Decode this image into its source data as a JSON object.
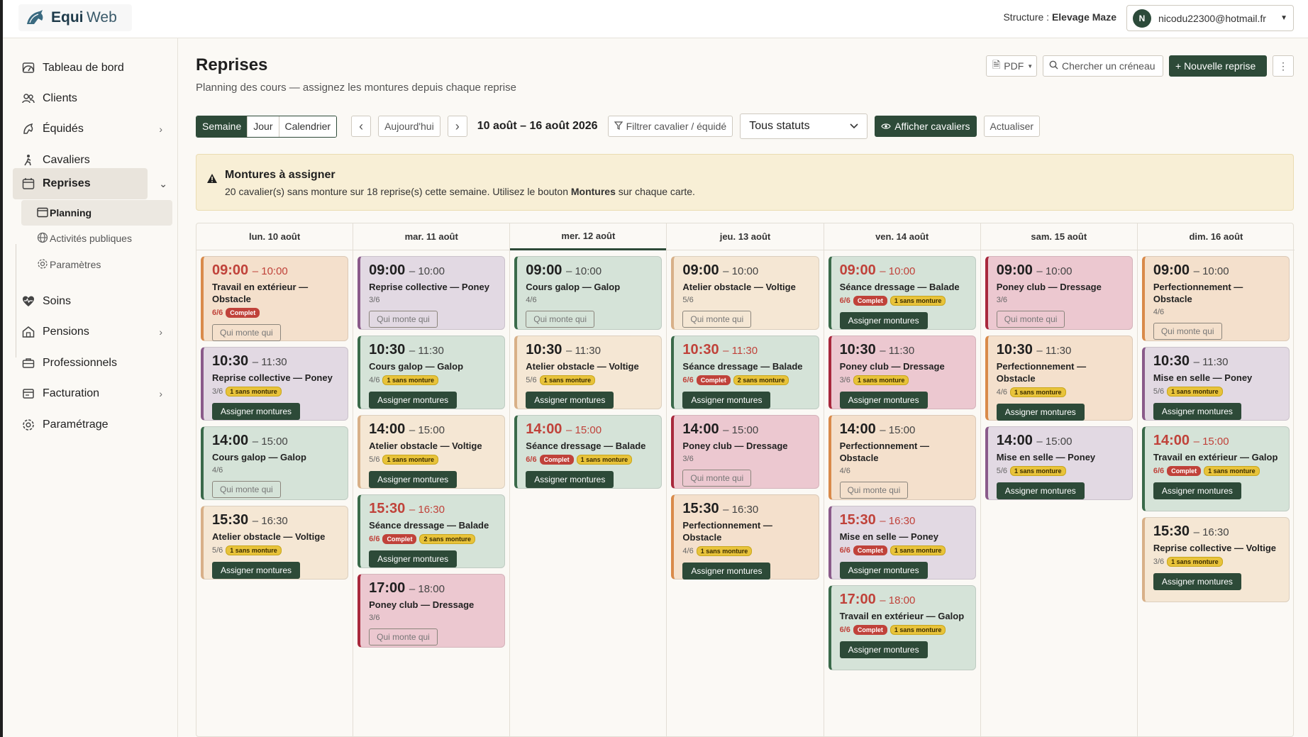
{
  "app": {
    "name_bold": "Equi",
    "name_light": "Web"
  },
  "topbar": {
    "structure_label": "Structure : ",
    "structure_name": "Elevage Maze",
    "user_initial": "N",
    "user_email": "nicodu22300@hotmail.fr"
  },
  "sidebar": {
    "items": [
      {
        "label": "Tableau de bord",
        "icon": "dashboard-icon"
      },
      {
        "label": "Clients",
        "icon": "users-icon"
      },
      {
        "label": "Équidés",
        "icon": "horse-icon"
      },
      {
        "label": "Cavaliers",
        "icon": "rider-icon"
      },
      {
        "label": "Reprises",
        "icon": "calendar-icon"
      },
      {
        "label": "Soins",
        "icon": "heart-pulse-icon"
      },
      {
        "label": "Pensions",
        "icon": "stable-icon"
      },
      {
        "label": "Professionnels",
        "icon": "briefcase-icon"
      },
      {
        "label": "Facturation",
        "icon": "invoice-icon"
      },
      {
        "label": "Paramétrage",
        "icon": "gear-icon"
      }
    ],
    "sub_items": [
      {
        "label": "Planning",
        "icon": "calendar-icon"
      },
      {
        "label": "Activités publiques",
        "icon": "globe-icon"
      },
      {
        "label": "Paramètres",
        "icon": "gear-icon"
      }
    ]
  },
  "page": {
    "title": "Reprises",
    "subtitle": "Planning des cours — assignez les montures depuis chaque reprise"
  },
  "header_buttons": {
    "pdf": "PDF",
    "search_slot": "Chercher un créneau",
    "new": "+ Nouvelle reprise",
    "more": "⋮"
  },
  "toolbar": {
    "views": [
      "Semaine",
      "Jour",
      "Calendrier"
    ],
    "prev": "‹",
    "today": "Aujourd'hui",
    "next": "›",
    "range": "10 août – 16 août 2026",
    "filter": "Filtrer cavalier / équidé",
    "status_select": "Tous statuts",
    "show_riders": "Afficher cavaliers",
    "refresh": "Actualiser"
  },
  "alert": {
    "title": "Montures à assigner",
    "text_before": "20 cavalier(s) sans monture sur 18 reprise(s) cette semaine. Utilisez le bouton ",
    "text_bold": "Montures",
    "text_after": " sur chaque carte."
  },
  "days": [
    {
      "label": "lun. 10 août",
      "cards": [
        {
          "start": "09:00",
          "end": "– 10:00",
          "title": "Travail en extérieur — Obstacle",
          "count": "6/6",
          "full": true,
          "missing": "",
          "button": "Qui monte qui",
          "color": "orange"
        },
        {
          "start": "10:30",
          "end": "– 11:30",
          "title": "Reprise collective — Poney",
          "count": "3/6",
          "full": false,
          "missing": "1 sans monture",
          "button": "Assigner montures",
          "color": "purple"
        },
        {
          "start": "14:00",
          "end": "– 15:00",
          "title": "Cours galop — Galop",
          "count": "4/6",
          "full": false,
          "missing": "",
          "button": "Qui monte qui",
          "color": "green"
        },
        {
          "start": "15:30",
          "end": "– 16:30",
          "title": "Atelier obstacle — Voltige",
          "count": "5/6",
          "full": false,
          "missing": "1 sans monture",
          "button": "Assigner montures",
          "color": "beige"
        }
      ]
    },
    {
      "label": "mar. 11 août",
      "cards": [
        {
          "start": "09:00",
          "end": "– 10:00",
          "title": "Reprise collective — Poney",
          "count": "3/6",
          "full": false,
          "missing": "",
          "button": "Qui monte qui",
          "color": "purple"
        },
        {
          "start": "10:30",
          "end": "– 11:30",
          "title": "Cours galop — Galop",
          "count": "4/6",
          "full": false,
          "missing": "1 sans monture",
          "button": "Assigner montures",
          "color": "green"
        },
        {
          "start": "14:00",
          "end": "– 15:00",
          "title": "Atelier obstacle — Voltige",
          "count": "5/6",
          "full": false,
          "missing": "1 sans monture",
          "button": "Assigner montures",
          "color": "beige"
        },
        {
          "start": "15:30",
          "end": "– 16:30",
          "title": "Séance dressage — Balade",
          "count": "6/6",
          "full": true,
          "missing": "2 sans monture",
          "button": "Assigner montures",
          "color": "green"
        },
        {
          "start": "17:00",
          "end": "– 18:00",
          "title": "Poney club — Dressage",
          "count": "3/6",
          "full": false,
          "missing": "",
          "button": "Qui monte qui",
          "color": "pink"
        }
      ]
    },
    {
      "label": "mer. 12 août",
      "cards": [
        {
          "start": "09:00",
          "end": "– 10:00",
          "title": "Cours galop — Galop",
          "count": "4/6",
          "full": false,
          "missing": "",
          "button": "Qui monte qui",
          "color": "green"
        },
        {
          "start": "10:30",
          "end": "– 11:30",
          "title": "Atelier obstacle — Voltige",
          "count": "5/6",
          "full": false,
          "missing": "1 sans monture",
          "button": "Assigner montures",
          "color": "beige"
        },
        {
          "start": "14:00",
          "end": "– 15:00",
          "title": "Séance dressage — Balade",
          "count": "6/6",
          "full": true,
          "missing": "1 sans monture",
          "button": "Assigner montures",
          "color": "green"
        }
      ]
    },
    {
      "label": "jeu. 13 août",
      "cards": [
        {
          "start": "09:00",
          "end": "– 10:00",
          "title": "Atelier obstacle — Voltige",
          "count": "5/6",
          "full": false,
          "missing": "",
          "button": "Qui monte qui",
          "color": "beige"
        },
        {
          "start": "10:30",
          "end": "– 11:30",
          "title": "Séance dressage — Balade",
          "count": "6/6",
          "full": true,
          "missing": "2 sans monture",
          "button": "Assigner montures",
          "color": "green"
        },
        {
          "start": "14:00",
          "end": "– 15:00",
          "title": "Poney club — Dressage",
          "count": "3/6",
          "full": false,
          "missing": "",
          "button": "Qui monte qui",
          "color": "pink"
        },
        {
          "start": "15:30",
          "end": "– 16:30",
          "title": "Perfectionnement — Obstacle",
          "count": "4/6",
          "full": false,
          "missing": "1 sans monture",
          "button": "Assigner montures",
          "color": "orange"
        }
      ]
    },
    {
      "label": "ven. 14 août",
      "cards": [
        {
          "start": "09:00",
          "end": "– 10:00",
          "title": "Séance dressage — Balade",
          "count": "6/6",
          "full": true,
          "missing": "1 sans monture",
          "button": "Assigner montures",
          "color": "green"
        },
        {
          "start": "10:30",
          "end": "– 11:30",
          "title": "Poney club — Dressage",
          "count": "3/6",
          "full": false,
          "missing": "1 sans monture",
          "button": "Assigner montures",
          "color": "pink"
        },
        {
          "start": "14:00",
          "end": "– 15:00",
          "title": "Perfectionnement — Obstacle",
          "count": "4/6",
          "full": false,
          "missing": "",
          "button": "Qui monte qui",
          "color": "orange"
        },
        {
          "start": "15:30",
          "end": "– 16:30",
          "title": "Mise en selle — Poney",
          "count": "6/6",
          "full": true,
          "missing": "1 sans monture",
          "button": "Assigner montures",
          "color": "purple"
        },
        {
          "start": "17:00",
          "end": "– 18:00",
          "title": "Travail en extérieur — Galop",
          "count": "6/6",
          "full": true,
          "missing": "1 sans monture",
          "button": "Assigner montures",
          "color": "green"
        }
      ]
    },
    {
      "label": "sam. 15 août",
      "cards": [
        {
          "start": "09:00",
          "end": "– 10:00",
          "title": "Poney club — Dressage",
          "count": "3/6",
          "full": false,
          "missing": "",
          "button": "Qui monte qui",
          "color": "pink"
        },
        {
          "start": "10:30",
          "end": "– 11:30",
          "title": "Perfectionnement — Obstacle",
          "count": "4/6",
          "full": false,
          "missing": "1 sans monture",
          "button": "Assigner montures",
          "color": "orange"
        },
        {
          "start": "14:00",
          "end": "– 15:00",
          "title": "Mise en selle — Poney",
          "count": "5/6",
          "full": false,
          "missing": "1 sans monture",
          "button": "Assigner montures",
          "color": "purple"
        }
      ]
    },
    {
      "label": "dim. 16 août",
      "cards": [
        {
          "start": "09:00",
          "end": "– 10:00",
          "title": "Perfectionnement — Obstacle",
          "count": "4/6",
          "full": false,
          "missing": "",
          "button": "Qui monte qui",
          "color": "orange"
        },
        {
          "start": "10:30",
          "end": "– 11:30",
          "title": "Mise en selle — Poney",
          "count": "5/6",
          "full": false,
          "missing": "1 sans monture",
          "button": "Assigner montures",
          "color": "purple"
        },
        {
          "start": "14:00",
          "end": "– 15:00",
          "title": "Travail en extérieur — Galop",
          "count": "6/6",
          "full": true,
          "missing": "1 sans monture",
          "button": "Assigner montures",
          "color": "green"
        },
        {
          "start": "15:30",
          "end": "– 16:30",
          "title": "Reprise collective — Voltige",
          "count": "3/6",
          "full": false,
          "missing": "1 sans monture",
          "button": "Assigner montures",
          "color": "beige"
        }
      ]
    }
  ],
  "labels": {
    "full": "Complet"
  },
  "colors": {
    "accent": "#2d4a38",
    "alert_bg": "#f8efd6",
    "full_red": "#c0423a",
    "missing_yellow": "#e8c33a"
  }
}
